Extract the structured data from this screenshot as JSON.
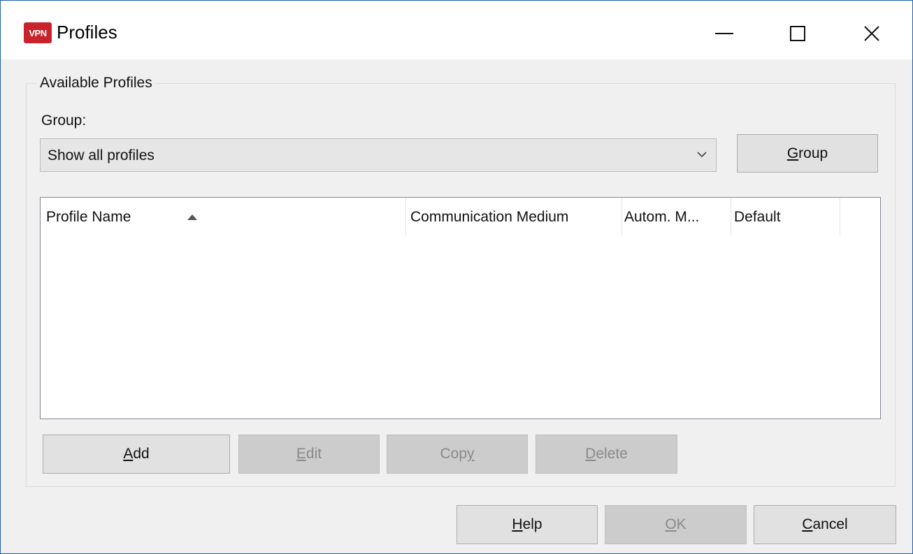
{
  "window": {
    "icon_text": "VPN",
    "icon": "vpn-app-icon",
    "title": "Profiles",
    "controls": {
      "minimize": "minimize-icon",
      "maximize": "maximize-icon",
      "close": "close-icon"
    }
  },
  "available_profiles": {
    "label": "Available Profiles",
    "group_label": "Group:",
    "group_select_value": "Show all profiles",
    "group_button": {
      "mnemonic": "G",
      "rest": "roup"
    }
  },
  "list": {
    "columns": [
      "Profile Name",
      "Communication Medium",
      "Autom. M...",
      "Default"
    ],
    "sort_indicator": "sort-ascending-icon",
    "rows": []
  },
  "buttons": {
    "add": {
      "mnemonic": "A",
      "rest": "dd",
      "enabled": true
    },
    "edit": {
      "mnemonic": "E",
      "rest": "dit",
      "enabled": false
    },
    "copy": {
      "pre": "Cop",
      "mnemonic": "y",
      "enabled": false
    },
    "delete": {
      "mnemonic": "D",
      "rest": "elete",
      "enabled": false
    },
    "help": {
      "mnemonic": "H",
      "rest": "elp",
      "enabled": true
    },
    "ok": {
      "mnemonic": "O",
      "rest": "K",
      "enabled": false
    },
    "cancel": {
      "mnemonic": "C",
      "rest": "ancel",
      "enabled": true
    }
  },
  "colors": {
    "app_icon_red": "#c8232c",
    "window_border": "#1f5fa8",
    "dialog_bg": "#f0f0f0",
    "disabled_button_bg": "#cccccc"
  }
}
